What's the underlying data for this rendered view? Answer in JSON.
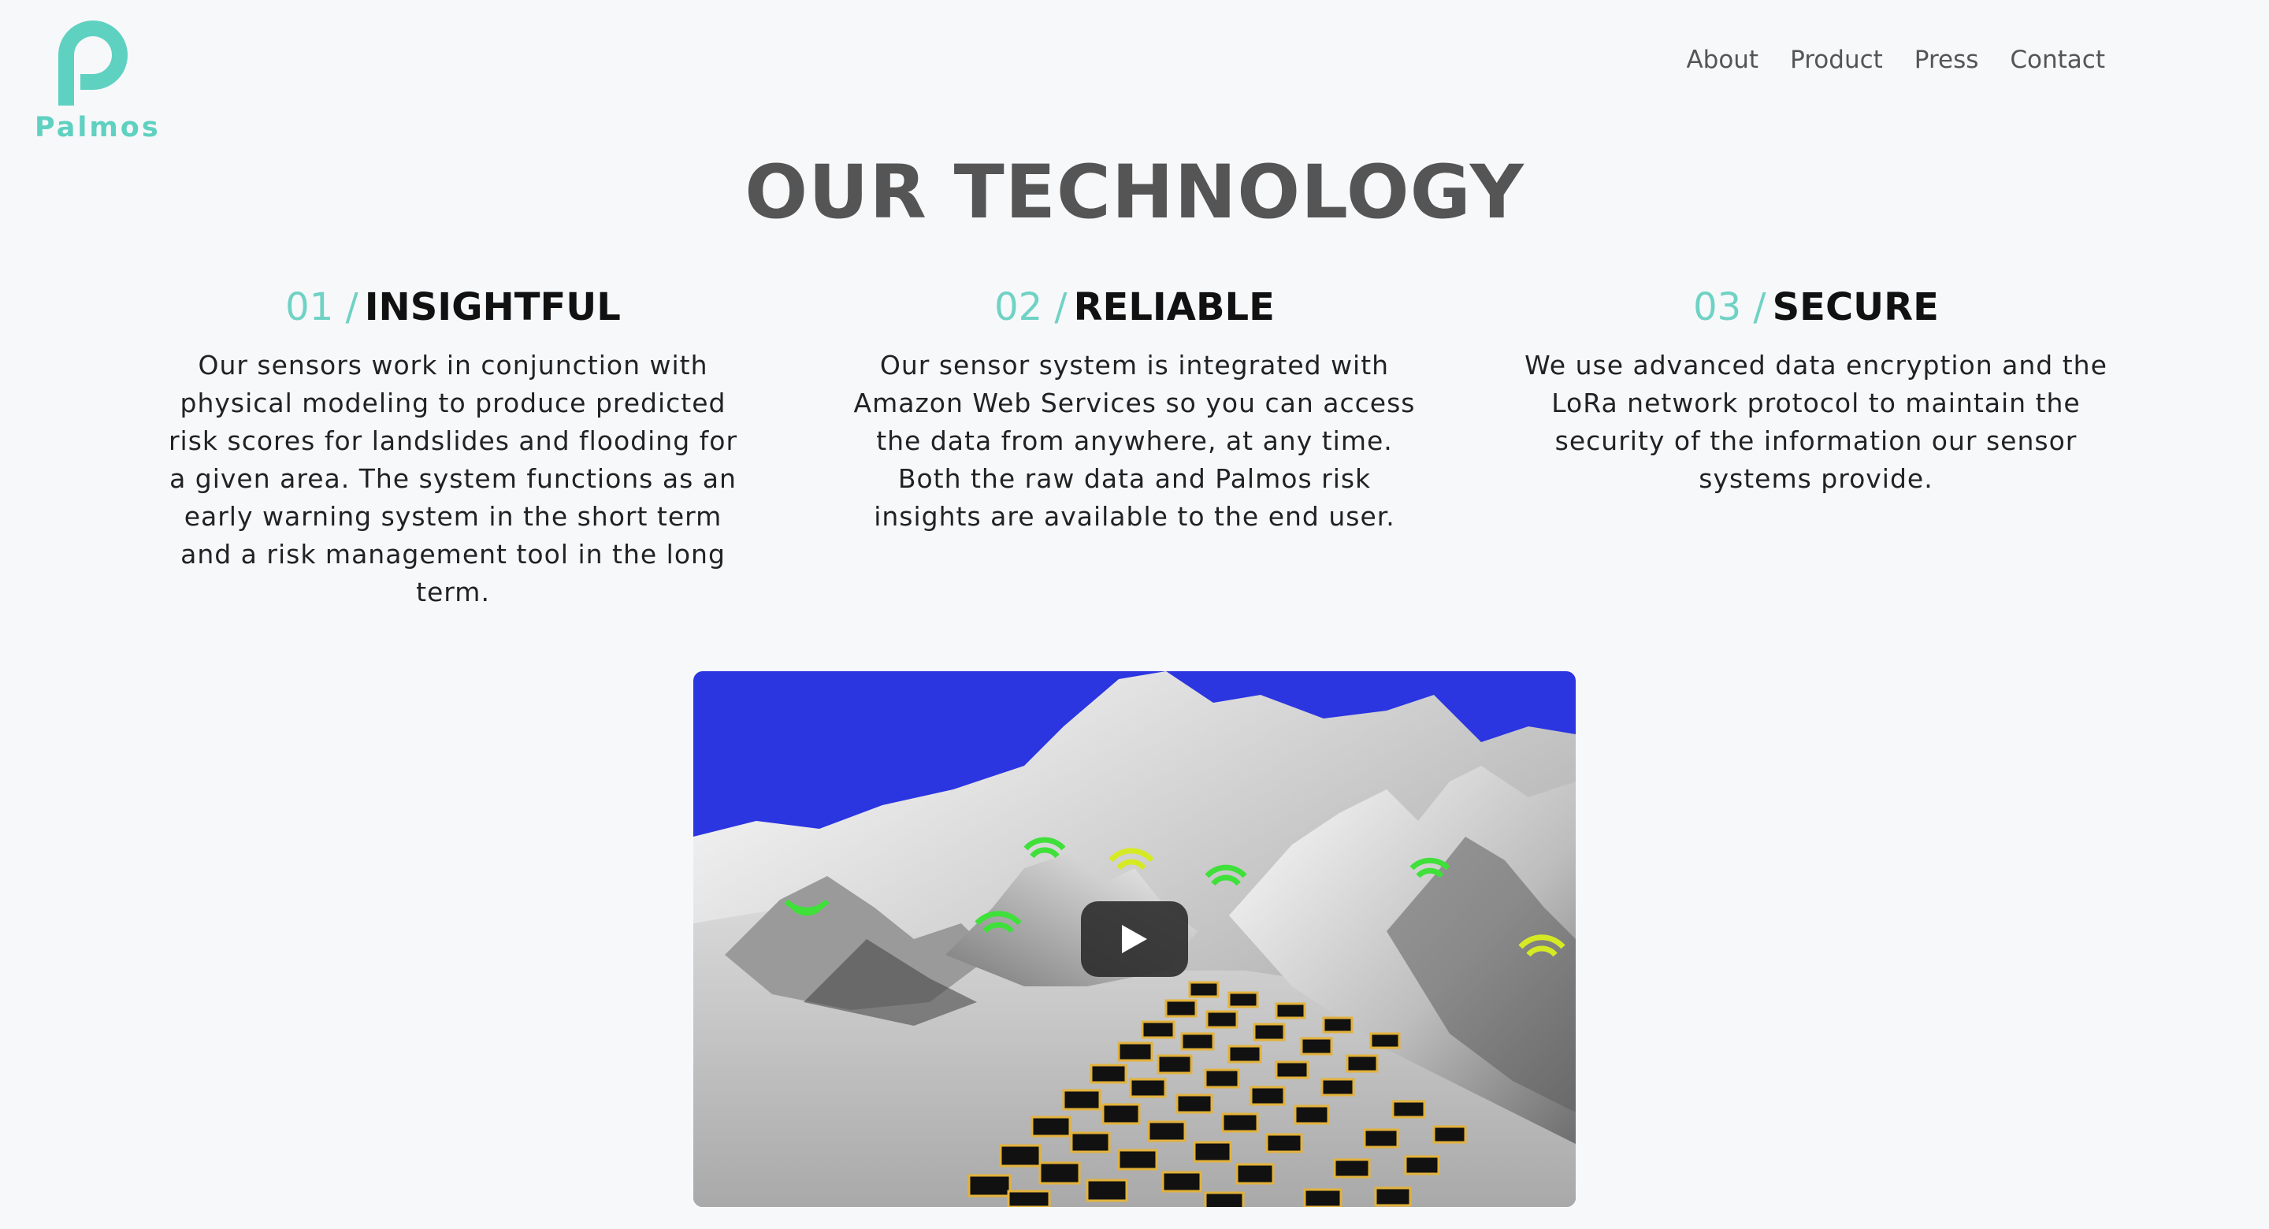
{
  "brand": {
    "name": "Palmos",
    "accent_color": "#5fd1c1"
  },
  "nav": {
    "items": [
      "About",
      "Product",
      "Press",
      "Contact"
    ]
  },
  "page_title": "OUR TECHNOLOGY",
  "features": [
    {
      "number": "01 /",
      "title": "INSIGHTFUL",
      "body": "Our sensors work in conjunction with physical modeling to produce predicted risk scores for landslides and flooding for a given area. The system functions as an early warning system in the short term and a risk management tool in the long term."
    },
    {
      "number": "02 /",
      "title": "RELIABLE",
      "body": "Our sensor system is integrated with Amazon Web Services so you can access the data from anywhere, at any time. Both the raw data and Palmos risk insights are available to the end user."
    },
    {
      "number": "03 /",
      "title": "SECURE",
      "body": "We use advanced data encryption and the LoRa network protocol to maintain the security of the information our sensor systems provide."
    }
  ],
  "video": {
    "sky_color": "#2b35e0",
    "play_icon": "play-icon"
  }
}
